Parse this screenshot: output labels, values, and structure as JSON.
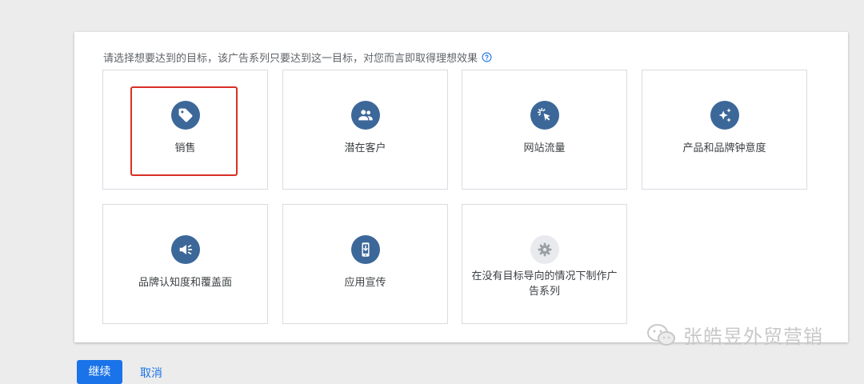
{
  "prompt": {
    "text": "请选择想要达到的目标，该广告系列只要达到这一目标，对您而言即取得理想效果",
    "help_icon": "question-circle-icon"
  },
  "goals": [
    {
      "label": "销售",
      "icon": "tag-icon",
      "selected": true
    },
    {
      "label": "潜在客户",
      "icon": "people-icon",
      "selected": false
    },
    {
      "label": "网站流量",
      "icon": "cursor-click-icon",
      "selected": false
    },
    {
      "label": "产品和品牌钟意度",
      "icon": "sparkle-icon",
      "selected": false
    },
    {
      "label": "品牌认知度和覆盖面",
      "icon": "megaphone-icon",
      "selected": false
    },
    {
      "label": "应用宣传",
      "icon": "mobile-download-icon",
      "selected": false
    },
    {
      "label": "在没有目标导向的情况下制作广告系列",
      "icon": "gear-icon",
      "selected": false
    }
  ],
  "actions": {
    "continue_label": "继续",
    "cancel_label": "取消"
  },
  "watermark": {
    "text": "张皓昱外贸营销"
  },
  "colors": {
    "icon_circle": "#3c6799",
    "icon_circle_gray": "#e8eaed",
    "selected_border": "#d93025",
    "primary": "#1a73e8"
  }
}
